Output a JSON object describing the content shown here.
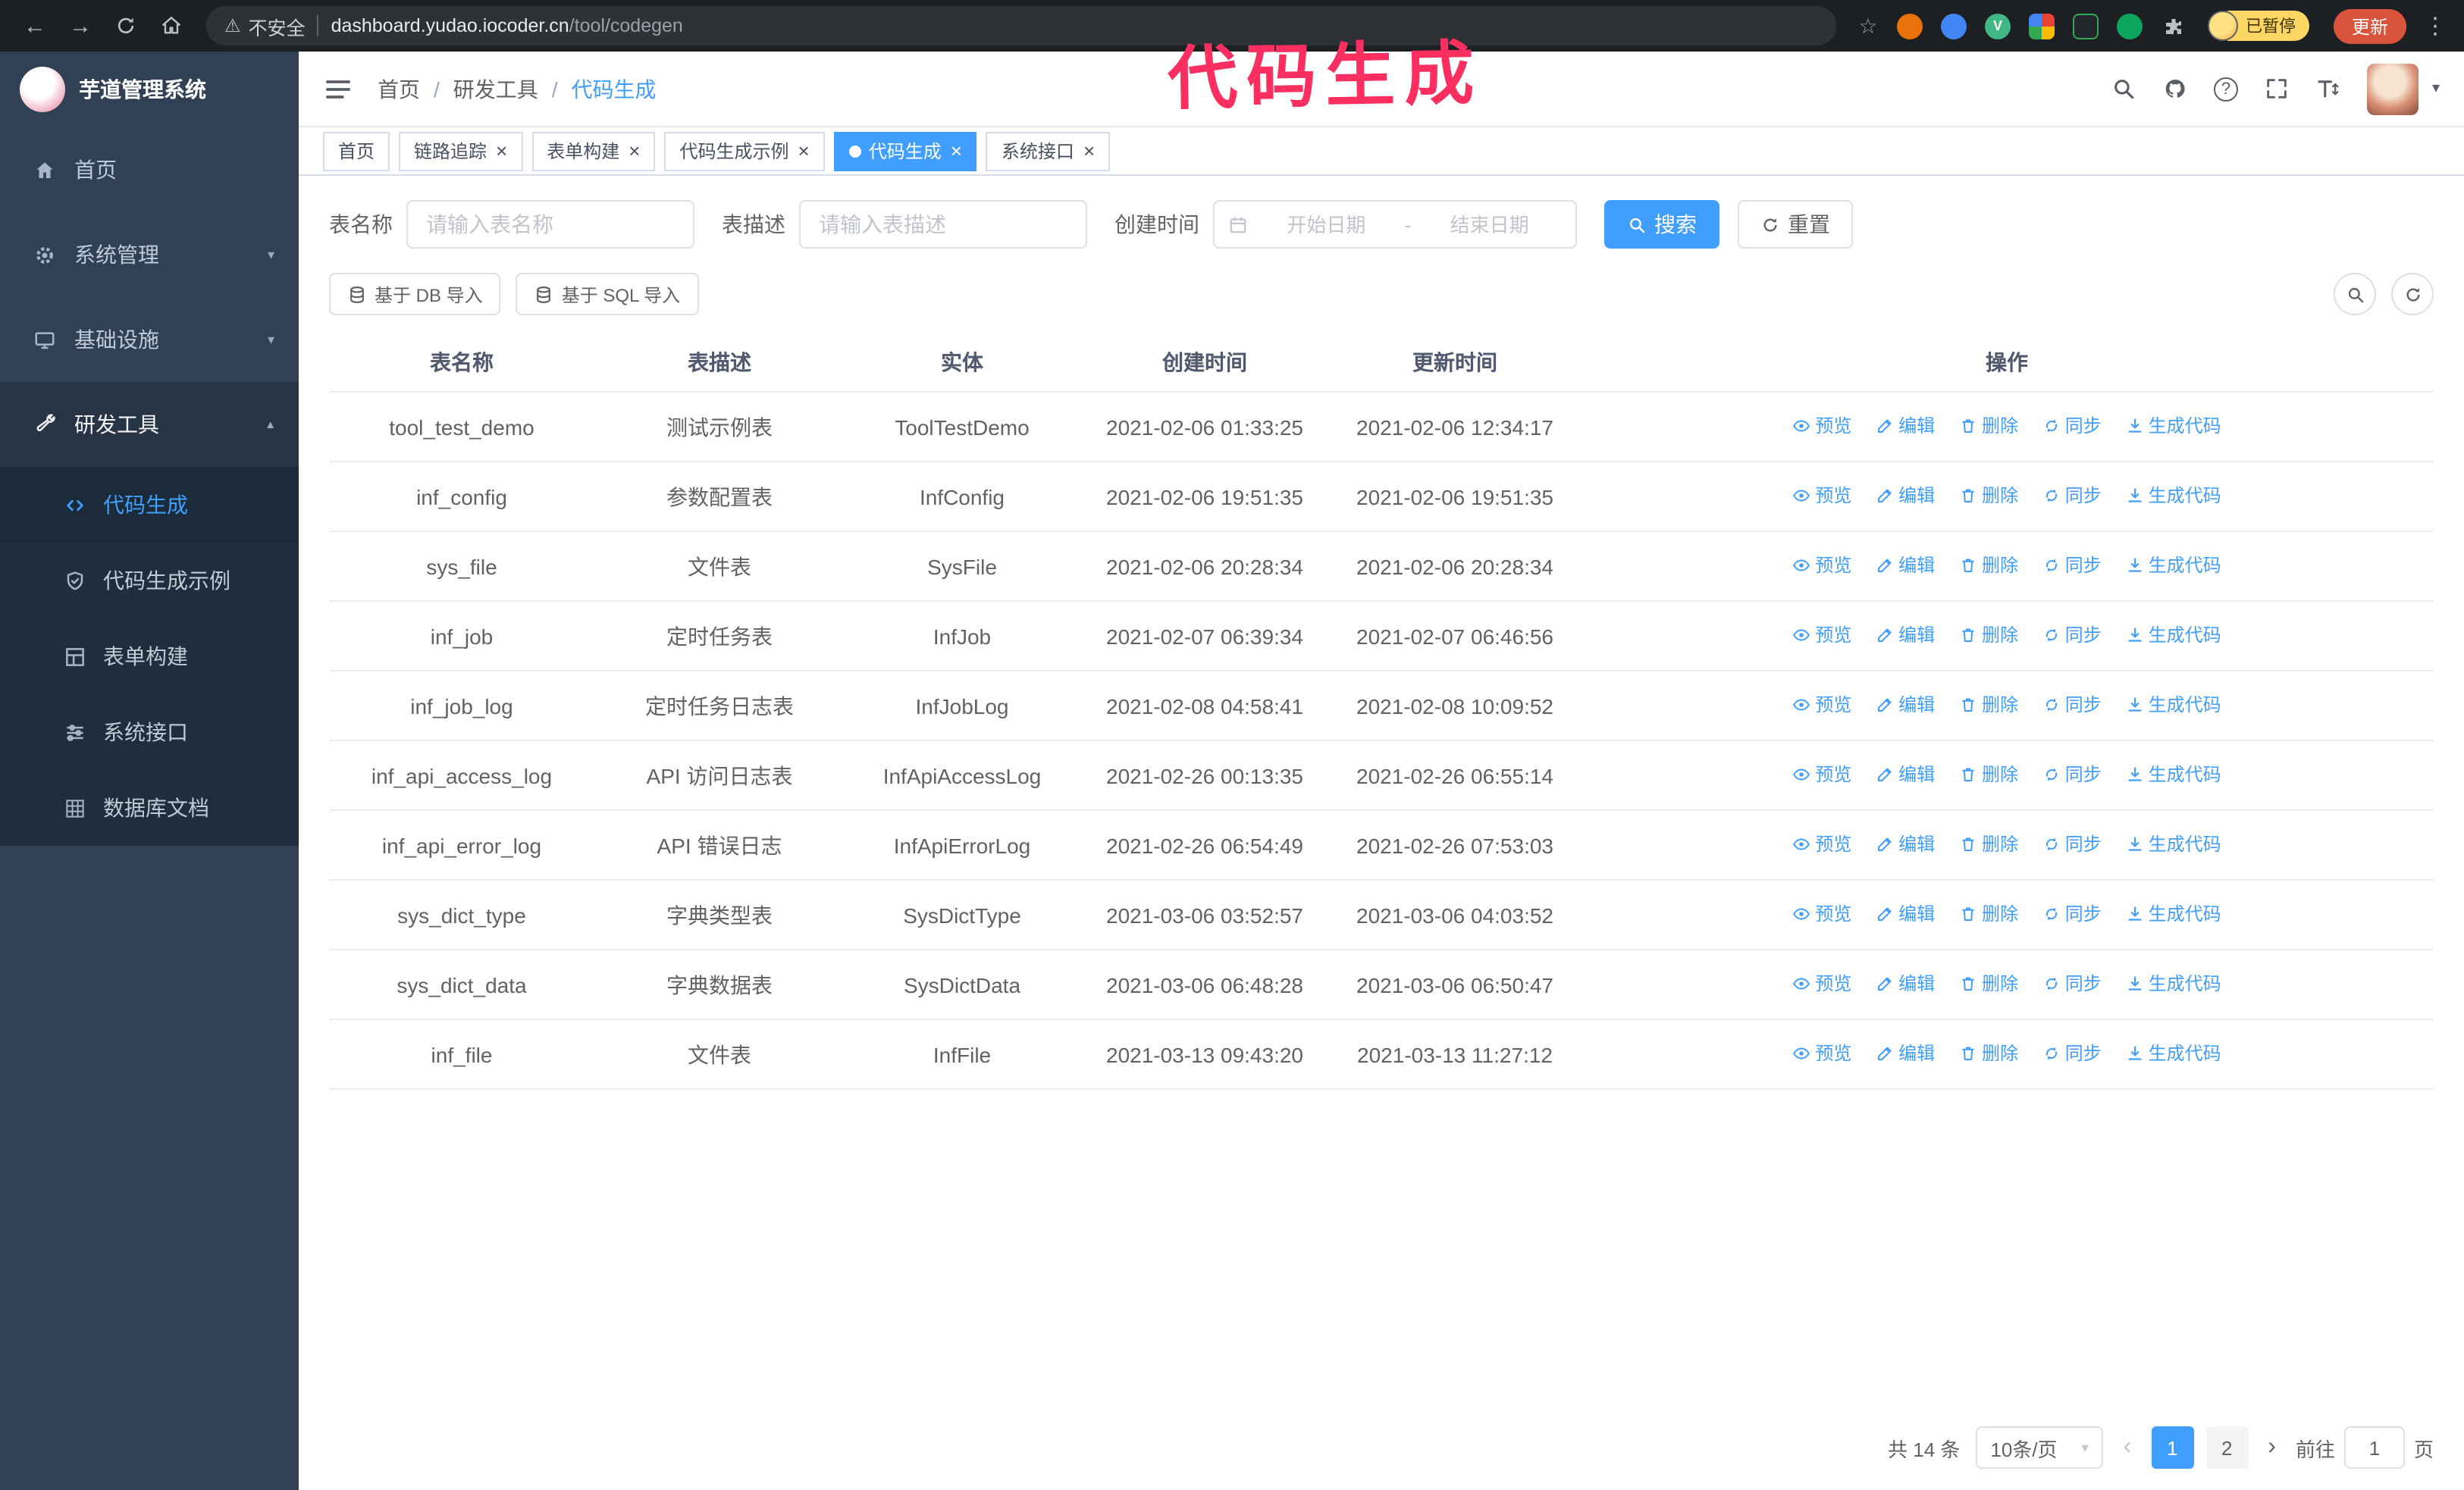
{
  "browser": {
    "security_label": "不安全",
    "url_host": "dashboard.yudao.iocoder.cn",
    "url_path": "/tool/codegen",
    "profile_badge": "已暂停",
    "update_button": "更新"
  },
  "annotation": {
    "text": "代码生成"
  },
  "glyphs": {
    "back": "←",
    "forward": "→",
    "star": "☆",
    "warning": "⚠",
    "kebab": "⋮",
    "caret_down": "▾",
    "prev": "‹",
    "next": "›",
    "close": "×",
    "breadcrumb_separator": "/",
    "question": "?"
  },
  "sidebar": {
    "logo_title": "芋道管理系统",
    "items": [
      {
        "key": "home",
        "label": "首页",
        "icon": "home"
      },
      {
        "key": "system",
        "label": "系统管理",
        "icon": "gear",
        "expandable": true
      },
      {
        "key": "infra",
        "label": "基础设施",
        "icon": "monitor",
        "expandable": true
      },
      {
        "key": "devtools",
        "label": "研发工具",
        "icon": "tools",
        "expandable": true,
        "expanded": true,
        "children": [
          {
            "key": "codegen",
            "label": "代码生成",
            "icon": "code",
            "active": true
          },
          {
            "key": "codegen-example",
            "label": "代码生成示例",
            "icon": "shield"
          },
          {
            "key": "form-builder",
            "label": "表单构建",
            "icon": "form"
          },
          {
            "key": "system-api",
            "label": "系统接口",
            "icon": "sliders"
          },
          {
            "key": "db-doc",
            "label": "数据库文档",
            "icon": "grid"
          }
        ]
      }
    ]
  },
  "header": {
    "breadcrumb": [
      "首页",
      "研发工具",
      "代码生成"
    ]
  },
  "tabs": [
    {
      "label": "首页",
      "closable": false
    },
    {
      "label": "链路追踪",
      "closable": true
    },
    {
      "label": "表单构建",
      "closable": true
    },
    {
      "label": "代码生成示例",
      "closable": true
    },
    {
      "label": "代码生成",
      "closable": true,
      "active": true
    },
    {
      "label": "系统接口",
      "closable": true
    }
  ],
  "filters": {
    "table_name_label": "表名称",
    "table_name_placeholder": "请输入表名称",
    "table_desc_label": "表描述",
    "table_desc_placeholder": "请输入表描述",
    "create_time_label": "创建时间",
    "date_start_placeholder": "开始日期",
    "date_separator": "-",
    "date_end_placeholder": "结束日期",
    "search_button": "搜索",
    "reset_button": "重置"
  },
  "toolbar": {
    "import_db": "基于 DB 导入",
    "import_sql": "基于 SQL 导入"
  },
  "table": {
    "columns": [
      "表名称",
      "表描述",
      "实体",
      "创建时间",
      "更新时间",
      "操作"
    ],
    "actions": [
      "预览",
      "编辑",
      "删除",
      "同步",
      "生成代码"
    ],
    "rows": [
      {
        "name": "tool_test_demo",
        "desc": "测试示例表",
        "entity": "ToolTestDemo",
        "created": "2021-02-06 01:33:25",
        "updated": "2021-02-06 12:34:17"
      },
      {
        "name": "inf_config",
        "desc": "参数配置表",
        "entity": "InfConfig",
        "created": "2021-02-06 19:51:35",
        "updated": "2021-02-06 19:51:35"
      },
      {
        "name": "sys_file",
        "desc": "文件表",
        "entity": "SysFile",
        "created": "2021-02-06 20:28:34",
        "updated": "2021-02-06 20:28:34"
      },
      {
        "name": "inf_job",
        "desc": "定时任务表",
        "entity": "InfJob",
        "created": "2021-02-07 06:39:34",
        "updated": "2021-02-07 06:46:56"
      },
      {
        "name": "inf_job_log",
        "desc": "定时任务日志表",
        "entity": "InfJobLog",
        "created": "2021-02-08 04:58:41",
        "updated": "2021-02-08 10:09:52"
      },
      {
        "name": "inf_api_access_log",
        "desc": "API 访问日志表",
        "entity": "InfApiAccessLog",
        "created": "2021-02-26 00:13:35",
        "updated": "2021-02-26 06:55:14"
      },
      {
        "name": "inf_api_error_log",
        "desc": "API 错误日志",
        "entity": "InfApiErrorLog",
        "created": "2021-02-26 06:54:49",
        "updated": "2021-02-26 07:53:03"
      },
      {
        "name": "sys_dict_type",
        "desc": "字典类型表",
        "entity": "SysDictType",
        "created": "2021-03-06 03:52:57",
        "updated": "2021-03-06 04:03:52"
      },
      {
        "name": "sys_dict_data",
        "desc": "字典数据表",
        "entity": "SysDictData",
        "created": "2021-03-06 06:48:28",
        "updated": "2021-03-06 06:50:47"
      },
      {
        "name": "inf_file",
        "desc": "文件表",
        "entity": "InfFile",
        "created": "2021-03-13 09:43:20",
        "updated": "2021-03-13 11:27:12"
      }
    ]
  },
  "pagination": {
    "total_text": "共 14 条",
    "page_size": "10条/页",
    "pages": [
      "1",
      "2"
    ],
    "active_page": "1",
    "goto_prefix": "前往",
    "goto_value": "1",
    "goto_suffix": "页"
  }
}
